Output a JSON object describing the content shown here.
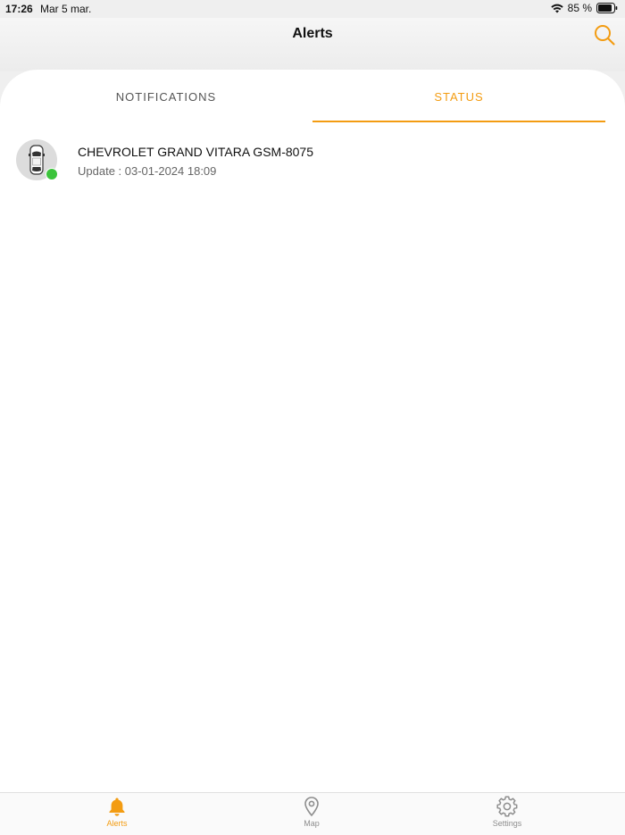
{
  "status_bar": {
    "time": "17:26",
    "date": "Mar 5 mar.",
    "battery": "85 %"
  },
  "header": {
    "title": "Alerts",
    "search_icon": "search-icon"
  },
  "tabs": [
    {
      "label": "NOTIFICATIONS",
      "active": false
    },
    {
      "label": "STATUS",
      "active": true
    }
  ],
  "vehicles": [
    {
      "name": "CHEVROLET GRAND VITARA GSM-8075",
      "update": "Update : 03-01-2024 18:09",
      "status": "online",
      "icon": "car-icon"
    }
  ],
  "tab_bar": {
    "items": [
      {
        "label": "Alerts",
        "icon": "bell-icon",
        "active": true
      },
      {
        "label": "Map",
        "icon": "map-pin-icon",
        "active": false
      },
      {
        "label": "Settings",
        "icon": "gear-icon",
        "active": false
      }
    ]
  },
  "colors": {
    "accent": "#f39c12",
    "online": "#3cc43c",
    "inactive": "#8e8e8e"
  }
}
